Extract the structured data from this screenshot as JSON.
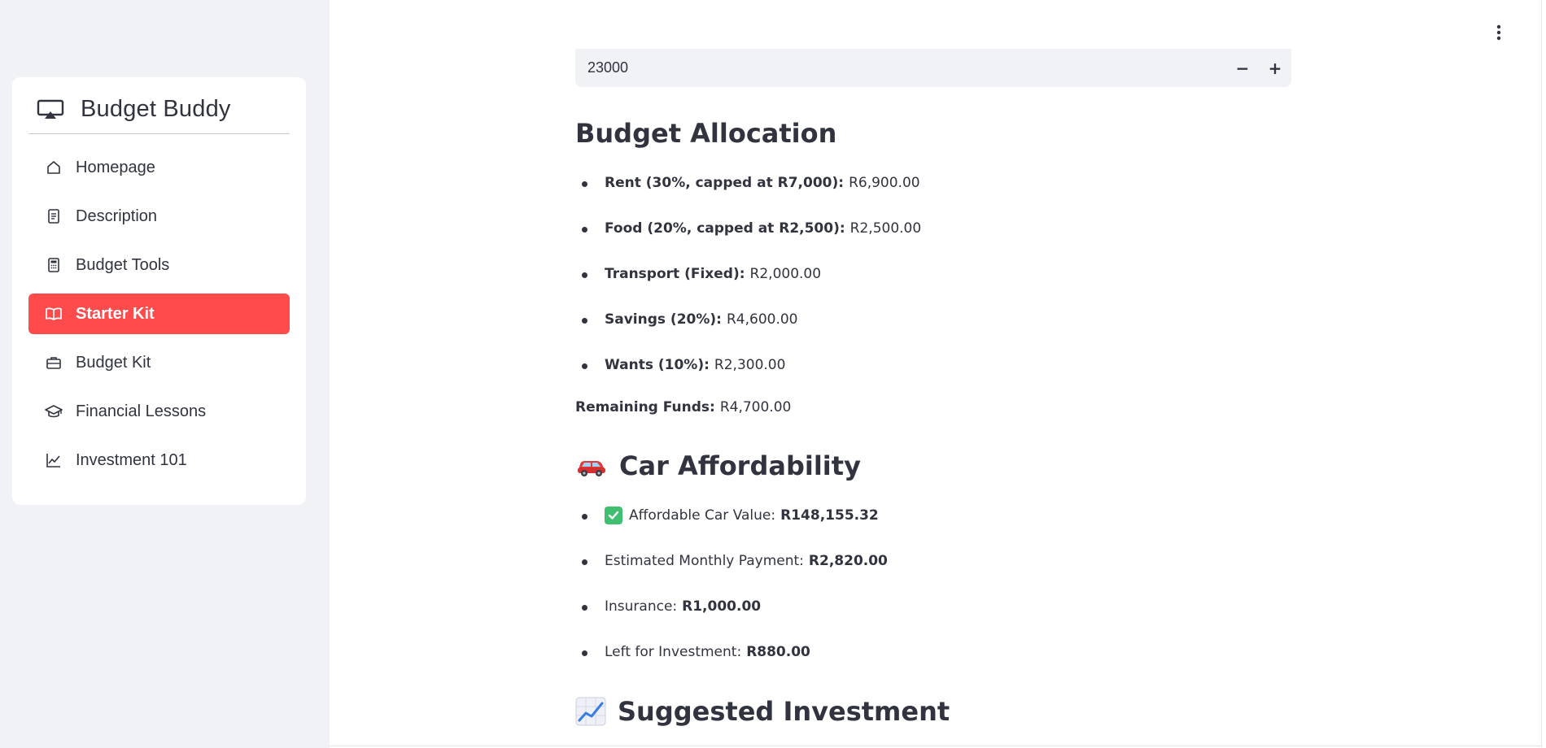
{
  "sidebar": {
    "brand_title": "Budget Buddy",
    "items": [
      {
        "label": "Homepage",
        "icon": "home-icon",
        "active": false
      },
      {
        "label": "Description",
        "icon": "document-icon",
        "active": false
      },
      {
        "label": "Budget Tools",
        "icon": "calculator-icon",
        "active": false
      },
      {
        "label": "Starter Kit",
        "icon": "book-icon",
        "active": true
      },
      {
        "label": "Budget Kit",
        "icon": "briefcase-icon",
        "active": false
      },
      {
        "label": "Financial Lessons",
        "icon": "graduation-cap-icon",
        "active": false
      },
      {
        "label": "Investment 101",
        "icon": "line-chart-icon",
        "active": false
      }
    ],
    "active_color": "#ff4b4b"
  },
  "main": {
    "income_input": {
      "value": "23000",
      "decrement_label": "−",
      "increment_label": "+"
    },
    "budget_allocation": {
      "heading": "Budget Allocation",
      "items": [
        {
          "label": "Rent (30%, capped at R7,000):",
          "value": "R6,900.00"
        },
        {
          "label": "Food (20%, capped at R2,500):",
          "value": "R2,500.00"
        },
        {
          "label": "Transport (Fixed):",
          "value": "R2,000.00"
        },
        {
          "label": "Savings (20%):",
          "value": "R4,600.00"
        },
        {
          "label": "Wants (10%):",
          "value": "R2,300.00"
        }
      ],
      "remaining_label": "Remaining Funds:",
      "remaining_value": "R4,700.00"
    },
    "car_affordability": {
      "heading": "Car Affordability",
      "emoji": "car-emoji",
      "items": [
        {
          "label": "Affordable Car Value:",
          "value": "R148,155.32",
          "icon": "check-emoji"
        },
        {
          "label": "Estimated Monthly Payment:",
          "value": "R2,820.00"
        },
        {
          "label": "Insurance:",
          "value": "R1,000.00"
        },
        {
          "label": "Left for Investment:",
          "value": "R880.00"
        }
      ]
    },
    "suggested_investment": {
      "heading": "Suggested Investment",
      "emoji": "chart-increasing-emoji"
    }
  }
}
